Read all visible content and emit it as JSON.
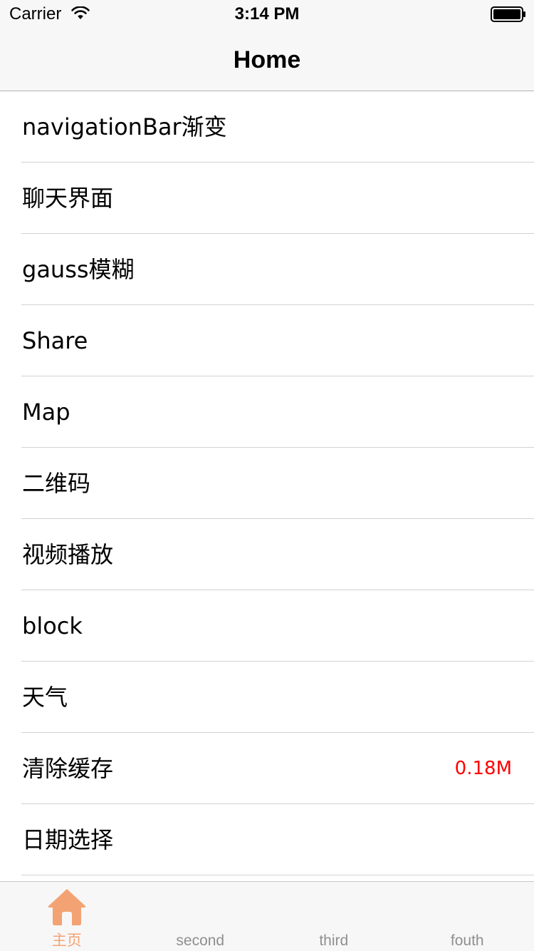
{
  "status_bar": {
    "carrier": "Carrier",
    "time": "3:14 PM",
    "icons": [
      "wifi-icon",
      "battery-icon"
    ]
  },
  "nav_bar": {
    "title": "Home"
  },
  "list": {
    "items": [
      {
        "label": "navigationBar渐变",
        "detail": ""
      },
      {
        "label": "聊天界面",
        "detail": ""
      },
      {
        "label": "gauss模糊",
        "detail": ""
      },
      {
        "label": "Share",
        "detail": ""
      },
      {
        "label": "Map",
        "detail": ""
      },
      {
        "label": "二维码",
        "detail": ""
      },
      {
        "label": "视频播放",
        "detail": ""
      },
      {
        "label": "block",
        "detail": ""
      },
      {
        "label": "天气",
        "detail": ""
      },
      {
        "label": "清除缓存",
        "detail": "0.18M"
      },
      {
        "label": "日期选择",
        "detail": ""
      }
    ],
    "detail_color": "#ff0000"
  },
  "tab_bar": {
    "tabs": [
      {
        "label": "主页",
        "icon": "home-icon",
        "active": true
      },
      {
        "label": "second",
        "icon": "",
        "active": false
      },
      {
        "label": "third",
        "icon": "",
        "active": false
      },
      {
        "label": "fouth",
        "icon": "",
        "active": false
      }
    ],
    "active_color": "#f3a373",
    "inactive_color": "#8f8f8f"
  }
}
